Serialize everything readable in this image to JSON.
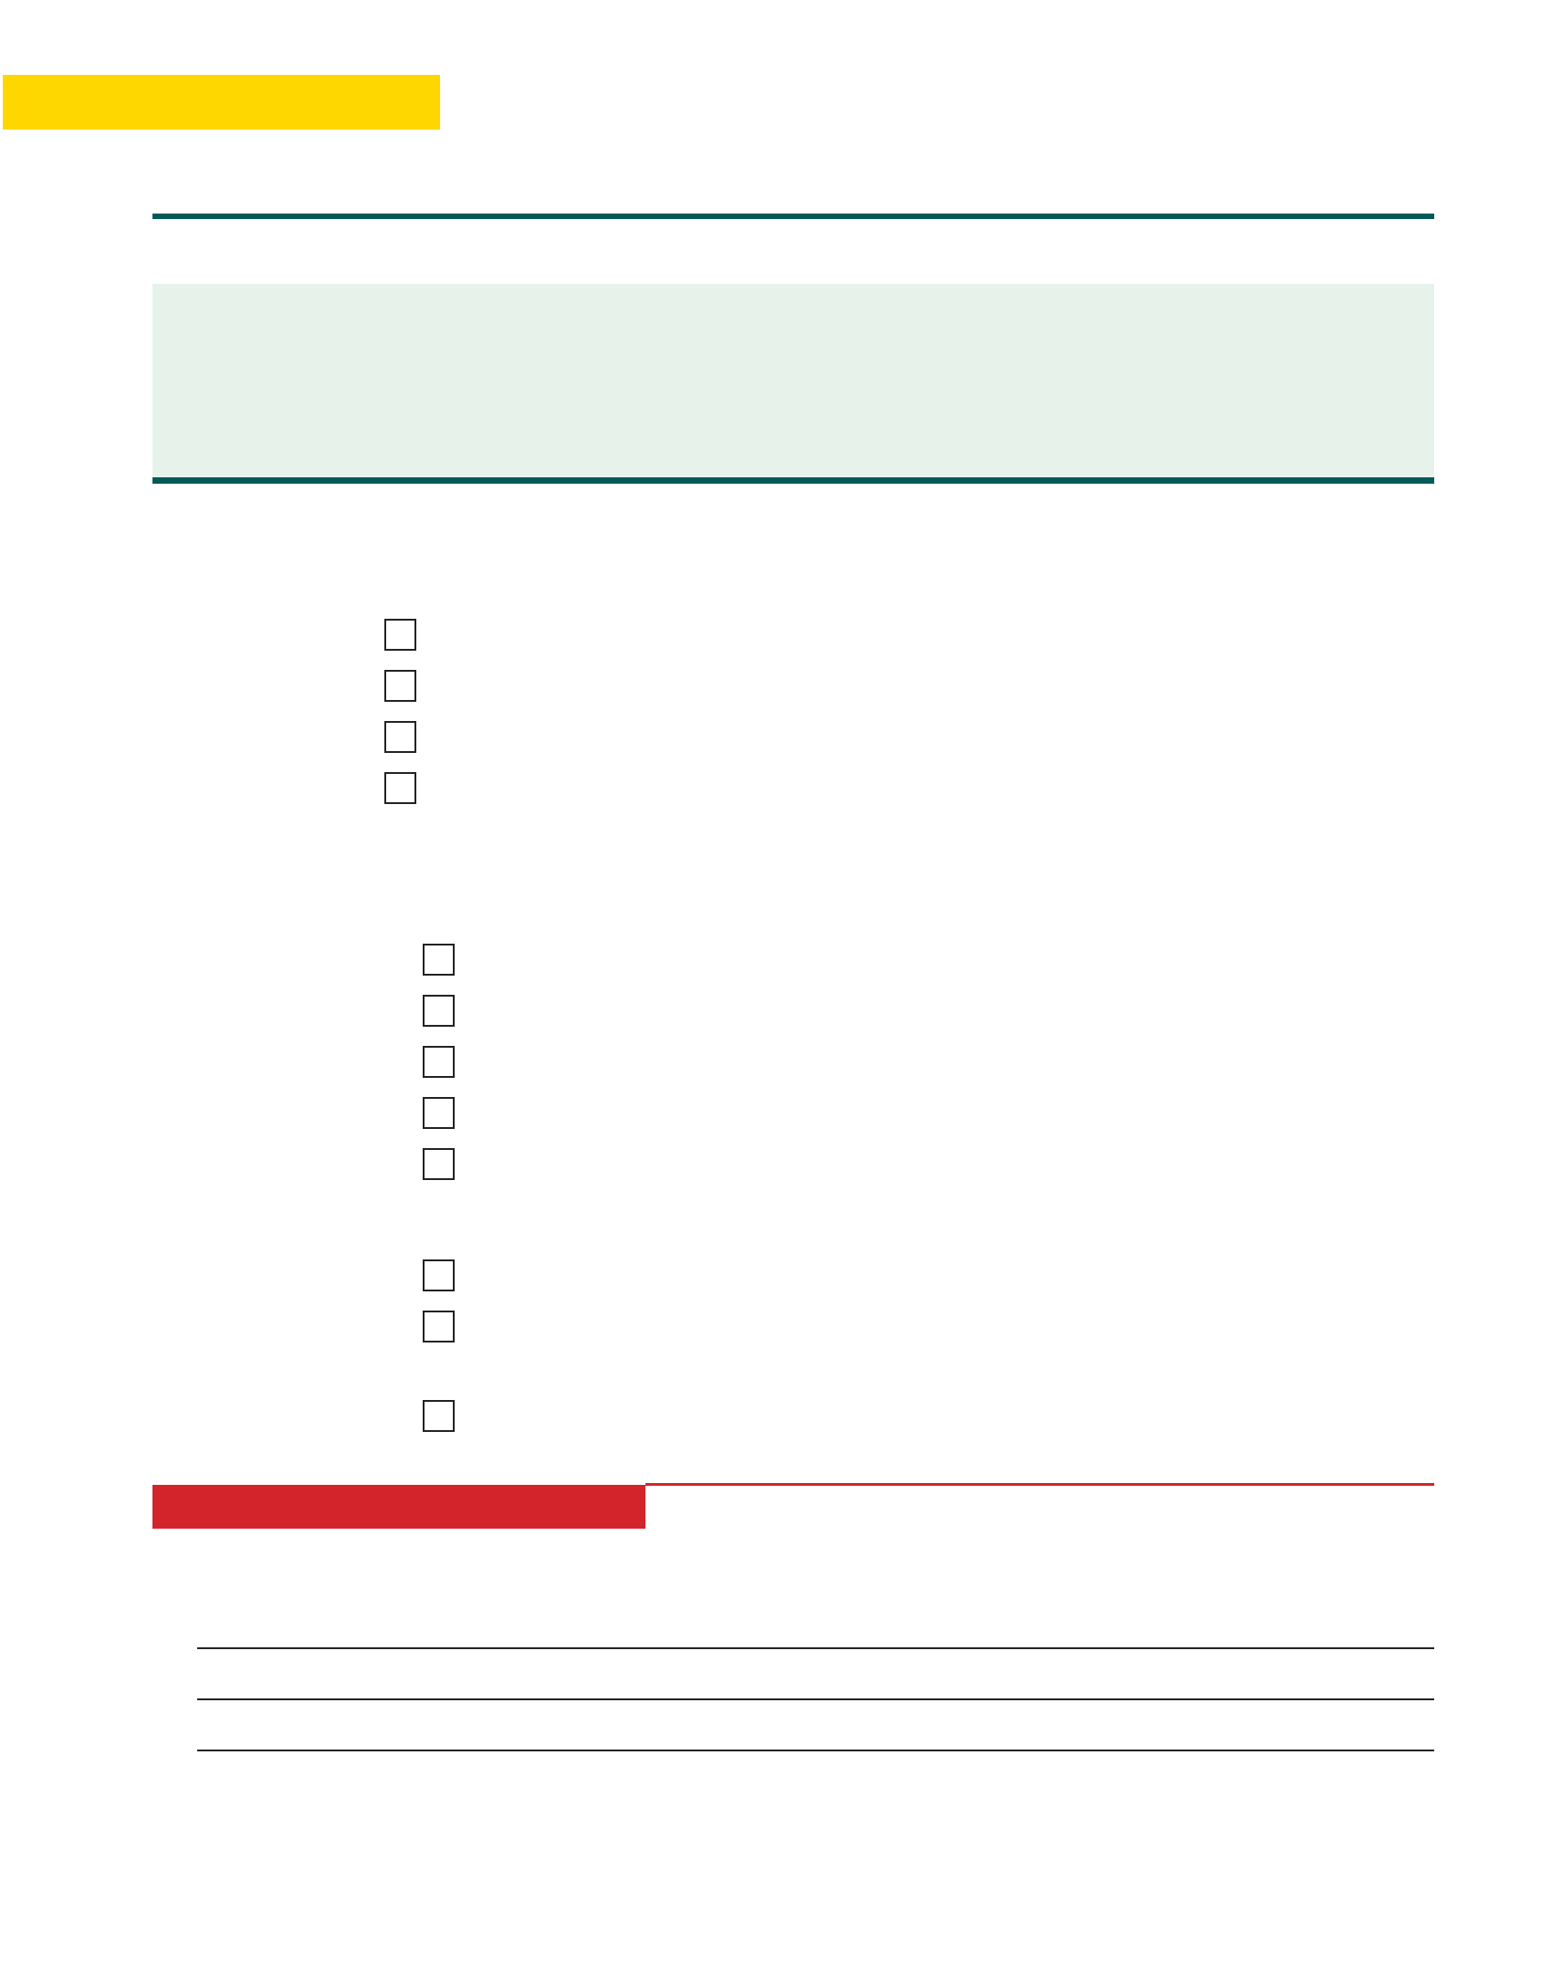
{
  "colors": {
    "header_tab": "#FFD700",
    "rule": "#005A57",
    "intro_box": "#E7F3EA",
    "section_label": "#D3242B",
    "checkbox_border": "#222222",
    "answer_line": "#222222"
  },
  "checklist": {
    "group_1": {
      "checkbox_count": 4
    },
    "group_2": {
      "checkbox_count": 8
    }
  },
  "answer_lines": {
    "count": 3
  }
}
